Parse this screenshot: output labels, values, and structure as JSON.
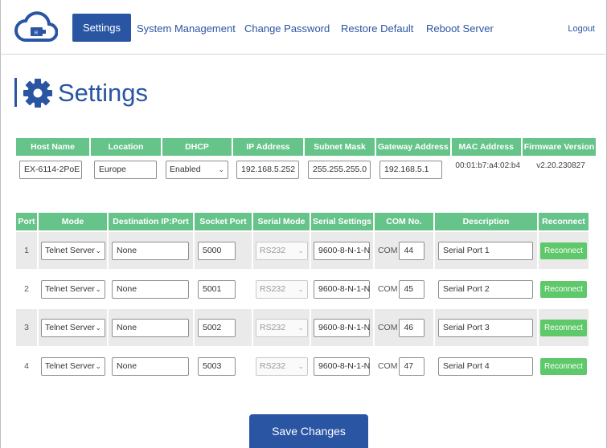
{
  "nav": {
    "items": [
      "Settings",
      "System Management",
      "Change Password",
      "Restore Default",
      "Reboot Server"
    ],
    "active": "Settings",
    "logout": "Logout",
    "logo_badge": "R"
  },
  "page": {
    "title": "Settings"
  },
  "host_table": {
    "headers": [
      "Host Name",
      "Location",
      "DHCP",
      "IP Address",
      "Subnet Mask",
      "Gateway Address",
      "MAC Address",
      "Firmware Version"
    ],
    "host_name": "EX-6114-2PoE",
    "location": "Europe",
    "dhcp": "Enabled",
    "ip_address": "192.168.5.252",
    "subnet_mask": "255.255.255.0",
    "gateway": "192.168.5.1",
    "mac": "00:01:b7:a4:02:b4",
    "firmware": "v2.20.230827"
  },
  "port_table": {
    "headers": [
      "Port",
      "Mode",
      "Destination IP:Port",
      "Socket Port",
      "Serial Mode",
      "Serial Settings",
      "COM No.",
      "Description",
      "Reconnect"
    ],
    "com_label": "COM",
    "rows": [
      {
        "port": "1",
        "mode": "Telnet Server",
        "dest": "None",
        "socket": "5000",
        "serial_mode": "RS232",
        "settings": "9600-8-N-1-N",
        "com": "44",
        "desc": "Serial Port 1",
        "btn": "Reconnect"
      },
      {
        "port": "2",
        "mode": "Telnet Server",
        "dest": "None",
        "socket": "5001",
        "serial_mode": "RS232",
        "settings": "9600-8-N-1-N",
        "com": "45",
        "desc": "Serial Port 2",
        "btn": "Reconnect"
      },
      {
        "port": "3",
        "mode": "Telnet Server",
        "dest": "None",
        "socket": "5002",
        "serial_mode": "RS232",
        "settings": "9600-8-N-1-N",
        "com": "46",
        "desc": "Serial Port 3",
        "btn": "Reconnect"
      },
      {
        "port": "4",
        "mode": "Telnet Server",
        "dest": "None",
        "socket": "5003",
        "serial_mode": "RS232",
        "settings": "9600-8-N-1-N",
        "com": "47",
        "desc": "Serial Port 4",
        "btn": "Reconnect"
      }
    ]
  },
  "save_label": "Save Changes",
  "colors": {
    "brand": "#2a55a3",
    "header_green": "#66c48a",
    "button_green": "#5ec86a",
    "row_shade": "#eaeaea"
  }
}
